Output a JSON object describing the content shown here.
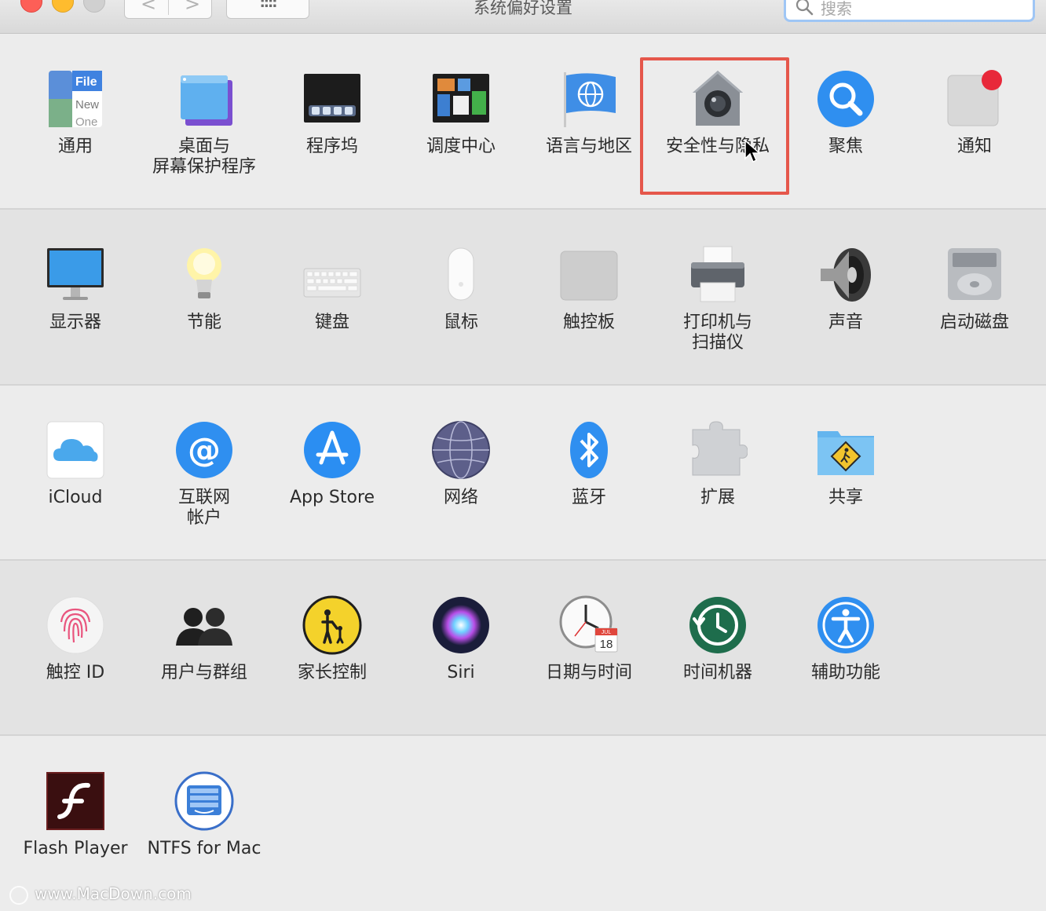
{
  "window": {
    "title": "系统偏好设置",
    "search_placeholder": "搜索",
    "show_all_glyph": "::::",
    "back_glyph": "<",
    "forward_glyph": ">"
  },
  "rows": [
    {
      "items": [
        {
          "label": "通用",
          "icon": "general-icon"
        },
        {
          "label": "桌面与\n屏幕保护程序",
          "icon": "desktop-screensaver-icon"
        },
        {
          "label": "程序坞",
          "icon": "dock-icon"
        },
        {
          "label": "调度中心",
          "icon": "mission-control-icon"
        },
        {
          "label": "语言与地区",
          "icon": "language-region-icon"
        },
        {
          "label": "安全性与隐私",
          "icon": "security-privacy-icon",
          "highlighted": true
        },
        {
          "label": "聚焦",
          "icon": "spotlight-icon"
        },
        {
          "label": "通知",
          "icon": "notifications-icon"
        }
      ]
    },
    {
      "items": [
        {
          "label": "显示器",
          "icon": "displays-icon"
        },
        {
          "label": "节能",
          "icon": "energy-saver-icon"
        },
        {
          "label": "键盘",
          "icon": "keyboard-icon"
        },
        {
          "label": "鼠标",
          "icon": "mouse-icon"
        },
        {
          "label": "触控板",
          "icon": "trackpad-icon"
        },
        {
          "label": "打印机与\n扫描仪",
          "icon": "printers-scanners-icon"
        },
        {
          "label": "声音",
          "icon": "sound-icon"
        },
        {
          "label": "启动磁盘",
          "icon": "startup-disk-icon"
        }
      ]
    },
    {
      "items": [
        {
          "label": "iCloud",
          "icon": "icloud-icon"
        },
        {
          "label": "互联网\n帐户",
          "icon": "internet-accounts-icon"
        },
        {
          "label": "App Store",
          "icon": "app-store-icon"
        },
        {
          "label": "网络",
          "icon": "network-icon"
        },
        {
          "label": "蓝牙",
          "icon": "bluetooth-icon"
        },
        {
          "label": "扩展",
          "icon": "extensions-icon"
        },
        {
          "label": "共享",
          "icon": "sharing-icon"
        }
      ]
    },
    {
      "items": [
        {
          "label": "触控 ID",
          "icon": "touch-id-icon"
        },
        {
          "label": "用户与群组",
          "icon": "users-groups-icon"
        },
        {
          "label": "家长控制",
          "icon": "parental-controls-icon"
        },
        {
          "label": "Siri",
          "icon": "siri-icon"
        },
        {
          "label": "日期与时间",
          "icon": "date-time-icon"
        },
        {
          "label": "时间机器",
          "icon": "time-machine-icon"
        },
        {
          "label": "辅助功能",
          "icon": "accessibility-icon"
        }
      ]
    },
    {
      "items": [
        {
          "label": "Flash Player",
          "icon": "flash-player-icon"
        },
        {
          "label": "NTFS for Mac",
          "icon": "ntfs-for-mac-icon"
        }
      ]
    }
  ],
  "general_icon_text": {
    "line1": "File",
    "line2": "New",
    "line3": "One"
  },
  "calendar_icon_text": {
    "month": "JUL",
    "day": "18"
  },
  "watermark": "www.MacDown.com",
  "colors": {
    "highlight_border": "#e5574b",
    "search_focus": "#9fc6f5",
    "close": "#fd5f57",
    "minimize": "#febc2e",
    "zoom": "#cfcfcf"
  }
}
